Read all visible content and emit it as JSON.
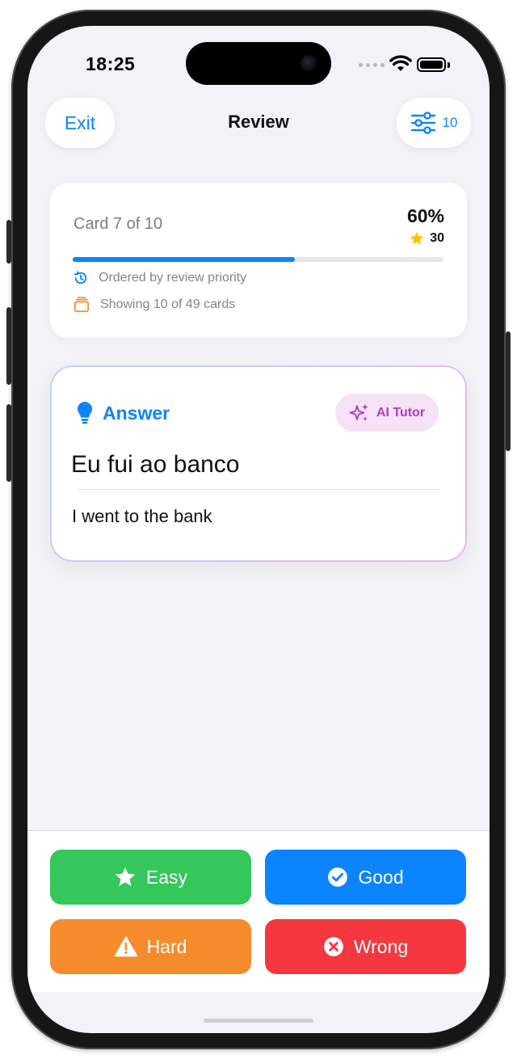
{
  "status_bar": {
    "time": "18:25"
  },
  "nav": {
    "exit_label": "Exit",
    "title": "Review",
    "filter_count": "10"
  },
  "progress": {
    "card_label": "Card 7 of 10",
    "percent_label": "60%",
    "progress_fraction": 0.6,
    "stars": "30",
    "ordering_text": "Ordered by review priority",
    "showing_text": "Showing 10 of 49 cards"
  },
  "answer": {
    "label": "Answer",
    "ai_tutor_label": "AI Tutor",
    "phrase": "Eu fui ao banco",
    "translation": "I went to the bank"
  },
  "actions": {
    "easy": "Easy",
    "good": "Good",
    "hard": "Hard",
    "wrong": "Wrong"
  },
  "colors": {
    "accent": "#0a84ff",
    "easy": "#34c759",
    "good": "#0a84ff",
    "hard": "#f68b2d",
    "wrong": "#f5373f",
    "ai_tutor": "#b03ac8",
    "star": "#ffc107"
  },
  "icons": {
    "filter": "sliders-icon",
    "star": "star-icon",
    "history": "clock-history-icon",
    "cards": "card-stack-icon",
    "answer": "lightbulb-icon",
    "ai_tutor": "sparkles-icon",
    "good": "checkmark-circle-icon",
    "hard": "warning-triangle-icon",
    "wrong": "x-circle-icon"
  }
}
